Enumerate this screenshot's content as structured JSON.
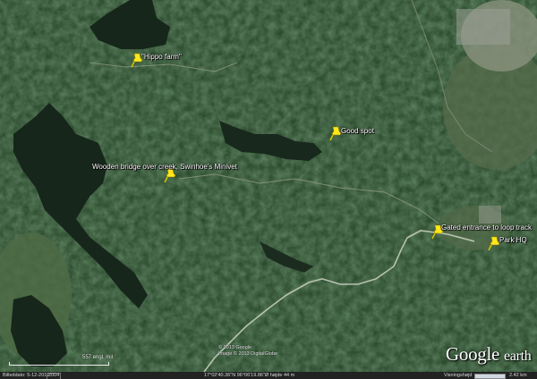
{
  "placemarks": [
    {
      "label": "\"Hippo farm\""
    },
    {
      "label": "Good spot"
    },
    {
      "label": "Wooden bridge over creek, Swinhoe's Minivet"
    },
    {
      "label": "Gated entrance to loop track"
    },
    {
      "label": "Park HQ"
    }
  ],
  "copyright": {
    "line1": "© 2013 Google",
    "line2": "Image © 2013 DigitalGlobe"
  },
  "scale": {
    "label": "557 engl. mil"
  },
  "logo": {
    "main": "Google",
    "suffix": "earth"
  },
  "status_bar": {
    "date": "Billeddato: 5-12-2012",
    "year": "2004",
    "coordinates": "17°02'40.36\"N  96°06'19.86\"Ø  højde  44 m",
    "streaming_label": "Visningshøjd",
    "streaming_percent": 100,
    "eye_alt": "2.42 km"
  },
  "colors": {
    "forest": "#2b4a2d",
    "lake": "#18271d",
    "road": "#b9c2b5",
    "pin": "#ffe71c"
  }
}
